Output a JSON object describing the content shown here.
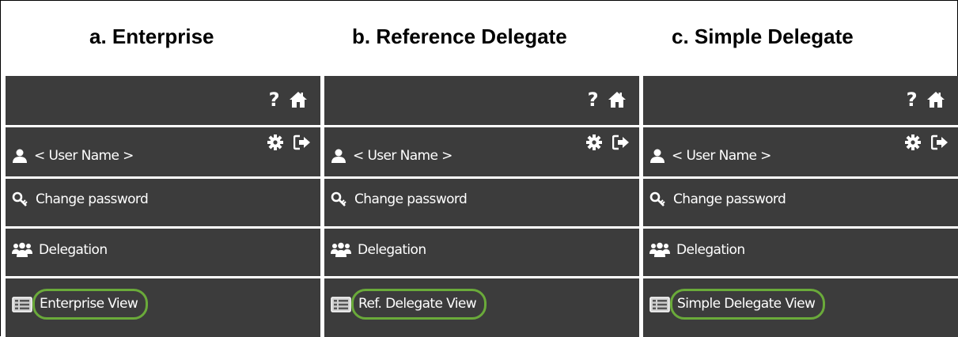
{
  "panels": [
    {
      "title": "a. Enterprise",
      "help_label": "?",
      "user_name": "< User Name >",
      "change_password": "Change password",
      "delegation": "Delegation",
      "view_label": "Enterprise View"
    },
    {
      "title": "b. Reference Delegate",
      "help_label": "?",
      "user_name": "< User Name >",
      "change_password": "Change password",
      "delegation": "Delegation",
      "view_label": "Ref. Delegate View"
    },
    {
      "title": "c. Simple Delegate",
      "help_label": "?",
      "user_name": "< User Name >",
      "change_password": "Change password",
      "delegation": "Delegation",
      "view_label": "Simple Delegate View"
    }
  ],
  "icons": {
    "home": "home-icon",
    "settings": "gear-icon",
    "logout": "logout-icon",
    "user": "user-icon",
    "key": "key-icon",
    "group": "group-icon",
    "view": "list-view-icon"
  },
  "colors": {
    "menu_background": "#3c3c3c",
    "menu_text": "#ffffff",
    "highlight_outline": "#6aaa3a"
  }
}
